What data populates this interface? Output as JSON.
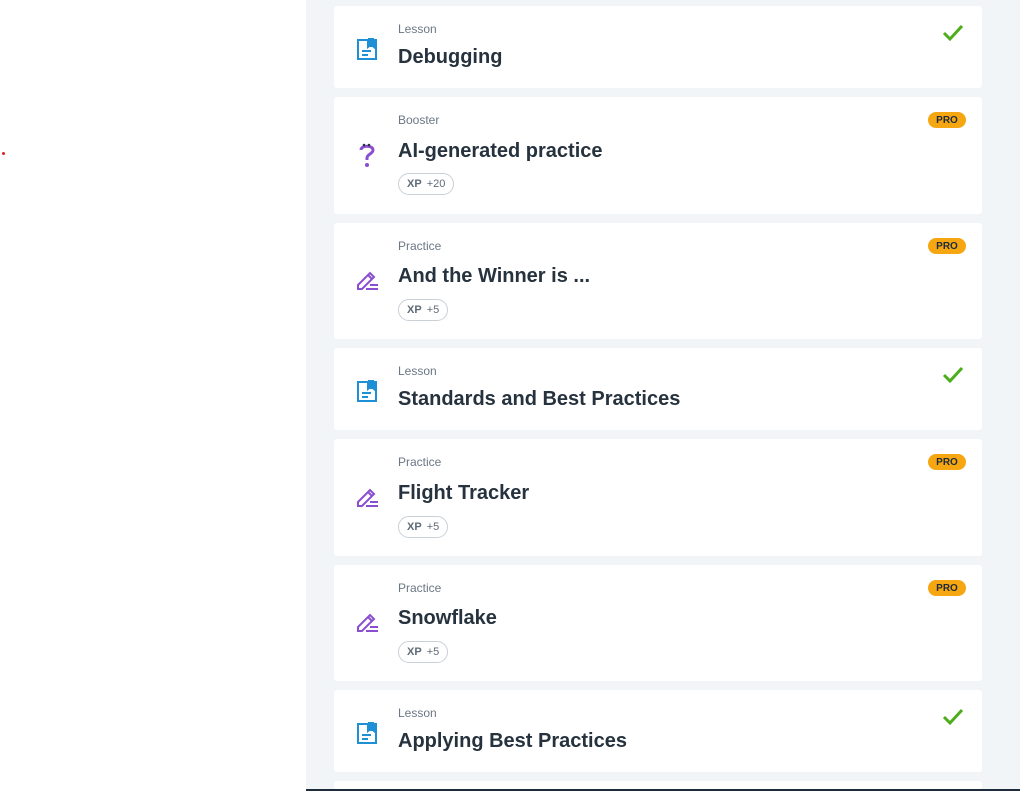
{
  "items": [
    {
      "kind": "Lesson",
      "title": "Debugging",
      "status": "completed",
      "icon": "lesson-icon"
    },
    {
      "kind": "Booster",
      "title": "AI-generated practice",
      "badge": "PRO",
      "xp_label": "XP",
      "xp_value": "+20",
      "icon": "booster-question-icon"
    },
    {
      "kind": "Practice",
      "title": "And the Winner is ...",
      "badge": "PRO",
      "xp_label": "XP",
      "xp_value": "+5",
      "icon": "practice-pencil-icon"
    },
    {
      "kind": "Lesson",
      "title": "Standards and Best Practices",
      "status": "completed",
      "icon": "lesson-icon"
    },
    {
      "kind": "Practice",
      "title": "Flight Tracker",
      "badge": "PRO",
      "xp_label": "XP",
      "xp_value": "+5",
      "icon": "practice-pencil-icon"
    },
    {
      "kind": "Practice",
      "title": "Snowflake",
      "badge": "PRO",
      "xp_label": "XP",
      "xp_value": "+5",
      "icon": "practice-pencil-icon"
    },
    {
      "kind": "Lesson",
      "title": "Applying Best Practices",
      "status": "completed",
      "icon": "lesson-icon"
    }
  ],
  "colors": {
    "lesson_icon": "#1f8fd6",
    "practice_icon": "#8a4fd1",
    "pro_badge": "#f6a611",
    "check": "#4cae1a",
    "panel_bg": "#f2f5f7"
  }
}
